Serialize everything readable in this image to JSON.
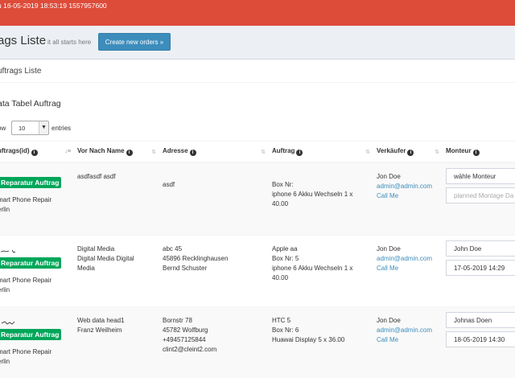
{
  "topbar": {
    "timestamp": "u 16-05-2019 18:53:19 1557957600"
  },
  "header": {
    "title": "ags Liste",
    "subtitle": "it all starts here",
    "create_button": "Create new orders »"
  },
  "box": {
    "title": "uftrags Liste"
  },
  "datatable": {
    "title": "ata Tabel Auftrag",
    "show_label": "ow",
    "length_value": "10",
    "entries_label": "entries",
    "columns": [
      {
        "label": "uftrags(id)"
      },
      {
        "label": "Vor Nach Name"
      },
      {
        "label": "Adresse"
      },
      {
        "label": "Auftrag"
      },
      {
        "label": "Verkäufer"
      },
      {
        "label": "Monteur"
      }
    ],
    "rows": [
      {
        "status": "Reparatur Auftrag",
        "shop": [
          "mart Phone Repair",
          "erlin"
        ],
        "name": [
          "asdfasdf asdf"
        ],
        "address": [
          "asdf"
        ],
        "order": [
          "Box Nr:",
          "iphone 6 Akku Wechseln 1 x",
          "40.00"
        ],
        "seller_name": "Jon Doe",
        "seller_email": "admin@admin.com",
        "seller_call": "Call Me",
        "monteur": "wähle Monteur",
        "date": "planned Montage Da"
      },
      {
        "status": "Reparatur Auftrag",
        "shop": [
          "mart Phone Repair",
          "erlin"
        ],
        "name": [
          "Digital Media",
          "Digital Media Digital",
          "Media"
        ],
        "address": [
          "abc 45",
          "45896 Recklinghausen",
          "Bernd Schuster"
        ],
        "order": [
          "Apple aa",
          "Box Nr: 5",
          "iphone 6 Akku Wechseln 1 x",
          "40.00"
        ],
        "seller_name": "Jon Doe",
        "seller_email": "admin@admin.com",
        "seller_call": "Call Me",
        "monteur": "John Doe",
        "date": "17-05-2019 14:29"
      },
      {
        "status": "Reparatur Auftrag",
        "shop": [
          "mart Phone Repair",
          "erlin"
        ],
        "name": [
          "Web data head1",
          "Franz Weilheim"
        ],
        "address": [
          "Bornstr 78",
          "45782 Wolfburg",
          "+49457125844",
          "clint2@cleint2.com"
        ],
        "order": [
          "HTC 5",
          "Box Nr: 6",
          "Huawai Display 5 x 36.00"
        ],
        "seller_name": "Jon Doe",
        "seller_email": "admin@admin.com",
        "seller_call": "Call Me",
        "monteur": "Johnas Doen",
        "date": "18-05-2019 14:30"
      }
    ]
  }
}
